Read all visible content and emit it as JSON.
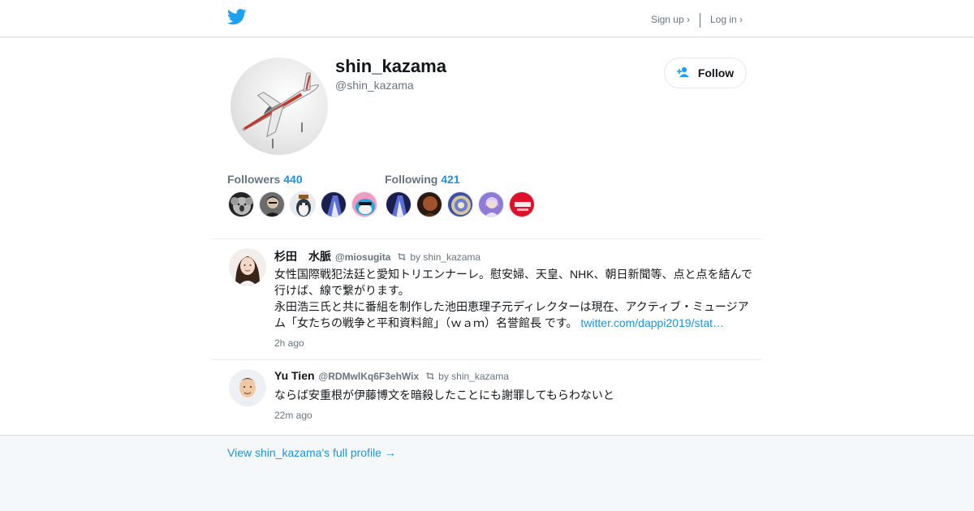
{
  "header": {
    "signup_label": "Sign up ›",
    "login_label": "Log in ›"
  },
  "profile": {
    "display_name": "shin_kazama",
    "screen_name": "@shin_kazama",
    "follow_label": "Follow",
    "followers_label": "Followers",
    "followers_count": "440",
    "following_label": "Following",
    "following_count": "421"
  },
  "tweets": [
    {
      "name": "杉田　水脈",
      "handle": "@miosugita",
      "retweet_label": "by shin_kazama",
      "text_lines": [
        "女性国際戦犯法廷と愛知トリエンナーレ。慰安婦、天皇、NHK、朝日新聞等、点と点を結んで",
        "行けば、線で繋がります。",
        "永田浩三氏と共に番組を制作した池田恵理子元ディレクターは現在、アクティブ・ミュージアム「女たちの戦争と平和資料館」（ｗａｍ）名誉館長 です。"
      ],
      "link": "twitter.com/dappi2019/stat…",
      "time": "2h ago"
    },
    {
      "name": "Yu Tien",
      "handle": "@RDMwlKq6F3ehWix",
      "retweet_label": "by shin_kazama",
      "text_lines": [
        "ならば安重根が伊藤博文を暗殺したことにも謝罪してもらわないと"
      ],
      "time": "22m ago"
    }
  ],
  "footer": {
    "full_profile_link": "View shin_kazama's full profile →"
  },
  "colors": {
    "accent": "#1b95e0",
    "twitter_blue": "#1da1f2",
    "muted": "#66757f"
  }
}
